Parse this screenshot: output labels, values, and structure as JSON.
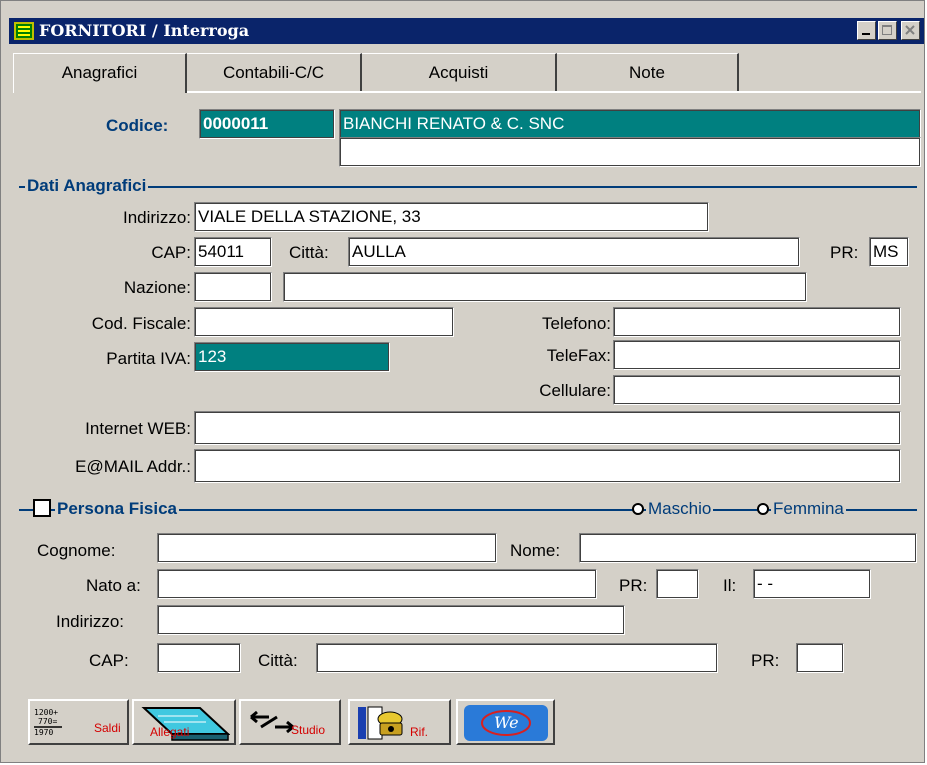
{
  "window": {
    "title": "FORNITORI / Interroga"
  },
  "tabs": [
    {
      "label": "Anagrafici",
      "active": true
    },
    {
      "label": "Contabili-C/C",
      "active": false
    },
    {
      "label": "Acquisti",
      "active": false
    },
    {
      "label": "Note",
      "active": false
    }
  ],
  "header": {
    "codice_label": "Codice:",
    "codice_value": "0000011",
    "ragione_sociale": "BIANCHI RENATO & C. SNC",
    "ragione_sociale_2": ""
  },
  "dati": {
    "section_title": "Dati Anagrafici",
    "indirizzo_label": "Indirizzo:",
    "indirizzo_value": "VIALE DELLA STAZIONE, 33",
    "cap_label": "CAP:",
    "cap_value": "54011",
    "citta_label": "Città:",
    "citta_value": "AULLA",
    "pr_label": "PR:",
    "pr_value": "MS",
    "nazione_label": "Nazione:",
    "nazione_code": "",
    "nazione_desc": "",
    "codfisc_label": "Cod. Fiscale:",
    "codfisc_value": "",
    "piva_label": "Partita IVA:",
    "piva_value": "123",
    "telefono_label": "Telefono:",
    "telefono_value": "",
    "telefax_label": "TeleFax:",
    "telefax_value": "",
    "cellulare_label": "Cellulare:",
    "cellulare_value": "",
    "web_label": "Internet WEB:",
    "web_value": "",
    "email_label": "E@MAIL Addr.:",
    "email_value": ""
  },
  "persona": {
    "section_title": "Persona Fisica",
    "checked": false,
    "maschio_label": "Maschio",
    "femmina_label": "Femmina",
    "cognome_label": "Cognome:",
    "cognome_value": "",
    "nome_label": "Nome:",
    "nome_value": "",
    "nato_label": "Nato a:",
    "nato_value": "",
    "pr_label": "PR:",
    "pr_value": "",
    "il_label": "Il:",
    "il_value": "- -",
    "indirizzo_label": "Indirizzo:",
    "indirizzo_value": "",
    "cap_label": "CAP:",
    "cap_value": "",
    "citta_label": "Città:",
    "citta_value": "",
    "pr2_label": "PR:",
    "pr2_value": ""
  },
  "toolbar": {
    "saldi_label": "Saldi",
    "saldi_numbers": [
      "1200+",
      "770=",
      "1970"
    ],
    "allegati_label": "Allegati",
    "studio_label": "Studio",
    "rif_label": "Rif.",
    "web_logo_text": "We"
  }
}
